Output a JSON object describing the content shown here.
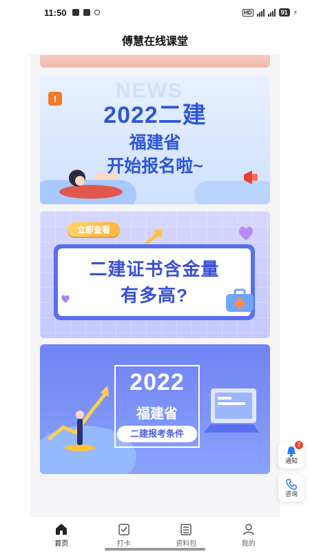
{
  "status_bar": {
    "time": "11:50",
    "battery": "91"
  },
  "header": {
    "title": "傅慧在线课堂"
  },
  "banners": [
    {
      "background_text": "NEWS",
      "year_title": "2022二建",
      "province": "福建省",
      "message": "开始报名啦~"
    },
    {
      "tag": "立即查看",
      "line1": "二建证书含金量",
      "line2": "有多高?"
    },
    {
      "year": "2022",
      "province": "福建省",
      "button": "二建报考条件"
    }
  ],
  "floating": {
    "notice_label": "通知",
    "notice_badge": "2",
    "consult_label": "咨询"
  },
  "tabs": [
    {
      "label": "首页",
      "icon": "home-icon",
      "active": true
    },
    {
      "label": "打卡",
      "icon": "checkin-icon",
      "active": false
    },
    {
      "label": "资料包",
      "icon": "materials-icon",
      "active": false
    },
    {
      "label": "我的",
      "icon": "profile-icon",
      "active": false
    }
  ],
  "colors": {
    "accent_blue": "#2f56d8",
    "badge_red": "#e8402f",
    "alert_orange": "#f07a2a"
  }
}
